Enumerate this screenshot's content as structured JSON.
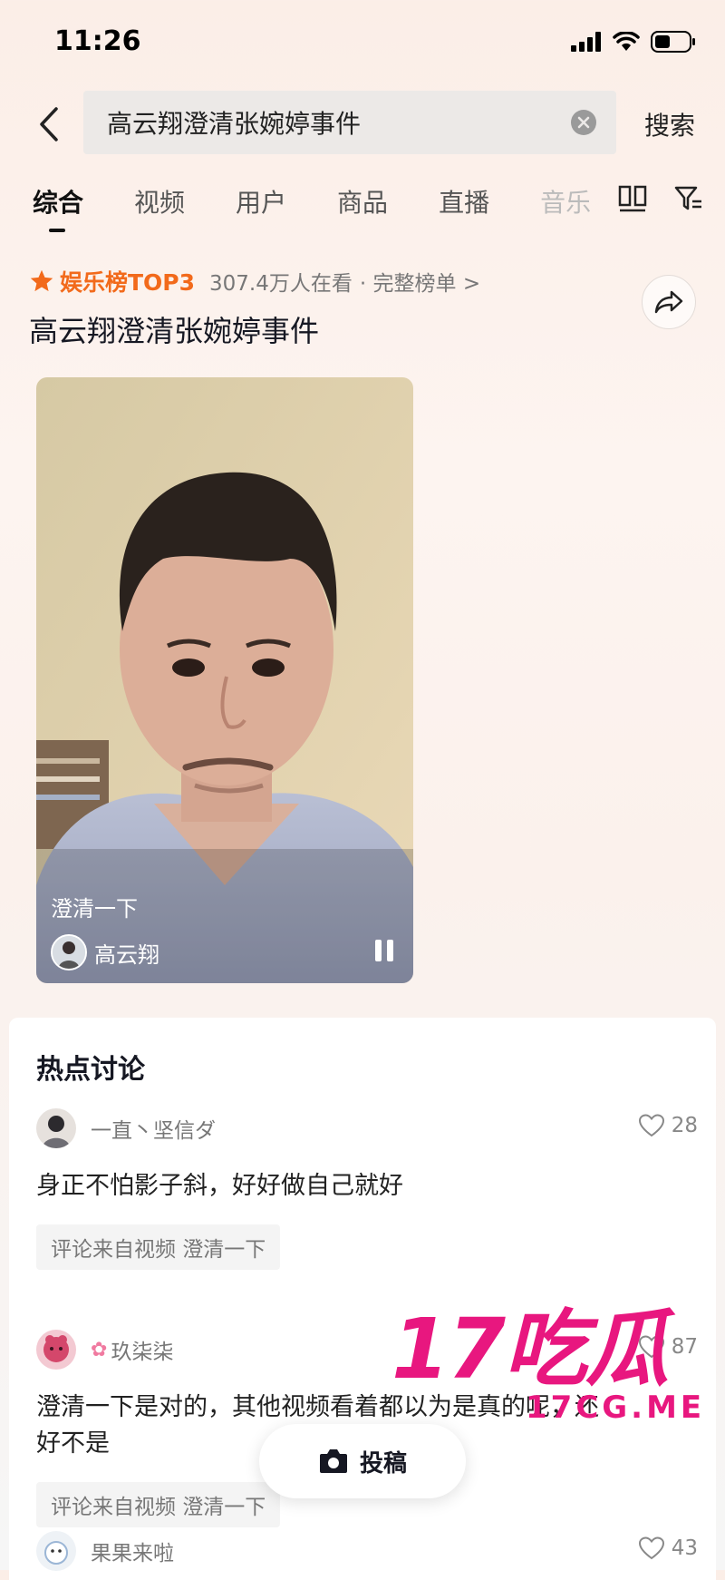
{
  "status_bar": {
    "time": "11:26"
  },
  "search": {
    "query": "高云翔澄清张婉婷事件",
    "button": "搜索"
  },
  "tabs": [
    "综合",
    "视频",
    "用户",
    "商品",
    "直播",
    "音乐"
  ],
  "hot_topic": {
    "badge": "娱乐榜TOP3",
    "watching": "307.4万人在看",
    "full_list": "· 完整榜单 >",
    "title": "高云翔澄清张婉婷事件"
  },
  "video": {
    "caption": "澄清一下",
    "author": "高云翔"
  },
  "discussion": {
    "title": "热点讨论",
    "comments": [
      {
        "user": "一直丶坚信ダ",
        "likes": "28",
        "text": "身正不怕影子斜，好好做自己就好",
        "source": "评论来自视频  澄清一下"
      },
      {
        "user": "玖柒柒",
        "likes": "87",
        "text": "澄清一下是对的，其他视频看着都以为是真的呢，还好不是",
        "source": "评论来自视频  澄清一下"
      },
      {
        "user": "果果来啦",
        "likes": "43"
      }
    ]
  },
  "post_button": "投稿",
  "watermark": {
    "brand": "17吃瓜",
    "domain": "17CG.ME"
  },
  "colors": {
    "accent": "#f26a1b",
    "watermark": "#e8177f"
  }
}
